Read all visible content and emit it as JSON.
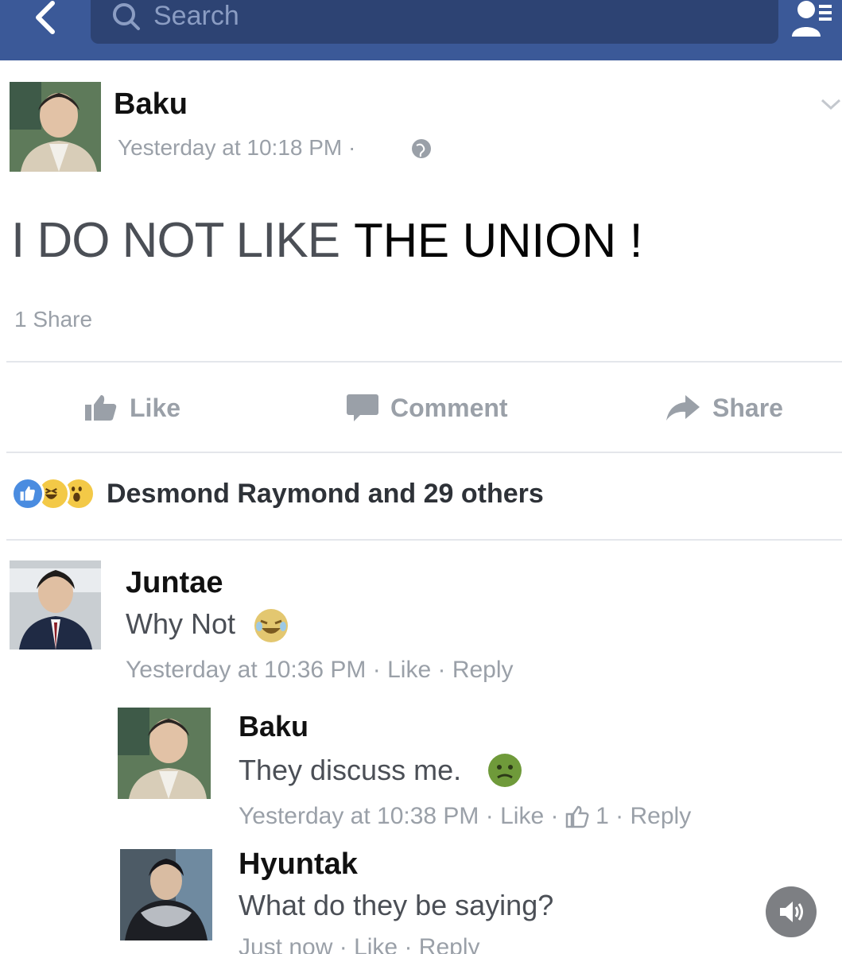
{
  "search": {
    "placeholder": "Search"
  },
  "post": {
    "author": "Baku",
    "timestamp": "Yesterday at 10:18 PM",
    "separator": "·",
    "text_faded": "I DO NOT LIKE",
    "text_overlay": "THE UNION !",
    "shares": "1 Share",
    "actions": {
      "like": "Like",
      "comment": "Comment",
      "share": "Share"
    },
    "reactions_text": "Desmond Raymond and 29 others"
  },
  "comments": [
    {
      "author": "Juntae",
      "text": "Why Not",
      "timestamp": "Yesterday at 10:36 PM",
      "like": "Like",
      "reply": "Reply"
    }
  ],
  "replies": [
    {
      "author": "Baku",
      "text": "They discuss me.",
      "timestamp": "Yesterday at 10:38 PM",
      "like": "Like",
      "like_count": "1",
      "reply": "Reply"
    },
    {
      "author": "Hyuntak",
      "text": "What do they be saying?",
      "timestamp": "Just now",
      "like": "Like",
      "reply": "Reply"
    }
  ],
  "colors": {
    "header": "#3b5998",
    "search_bg": "#2d4373",
    "like_reaction": "#4a8ce0",
    "emoji": "#f3c947",
    "meta": "#9aa0a8"
  },
  "icons": [
    "back-arrow-icon",
    "search-icon",
    "friend-requests-icon",
    "globe-icon",
    "chevron-down-icon",
    "like-icon",
    "comment-icon",
    "share-arrow-icon",
    "like-reaction-icon",
    "haha-reaction-icon",
    "wow-reaction-icon",
    "laughing-emoji-icon",
    "nauseated-emoji-icon",
    "thumbs-up-icon",
    "speaker-icon"
  ]
}
